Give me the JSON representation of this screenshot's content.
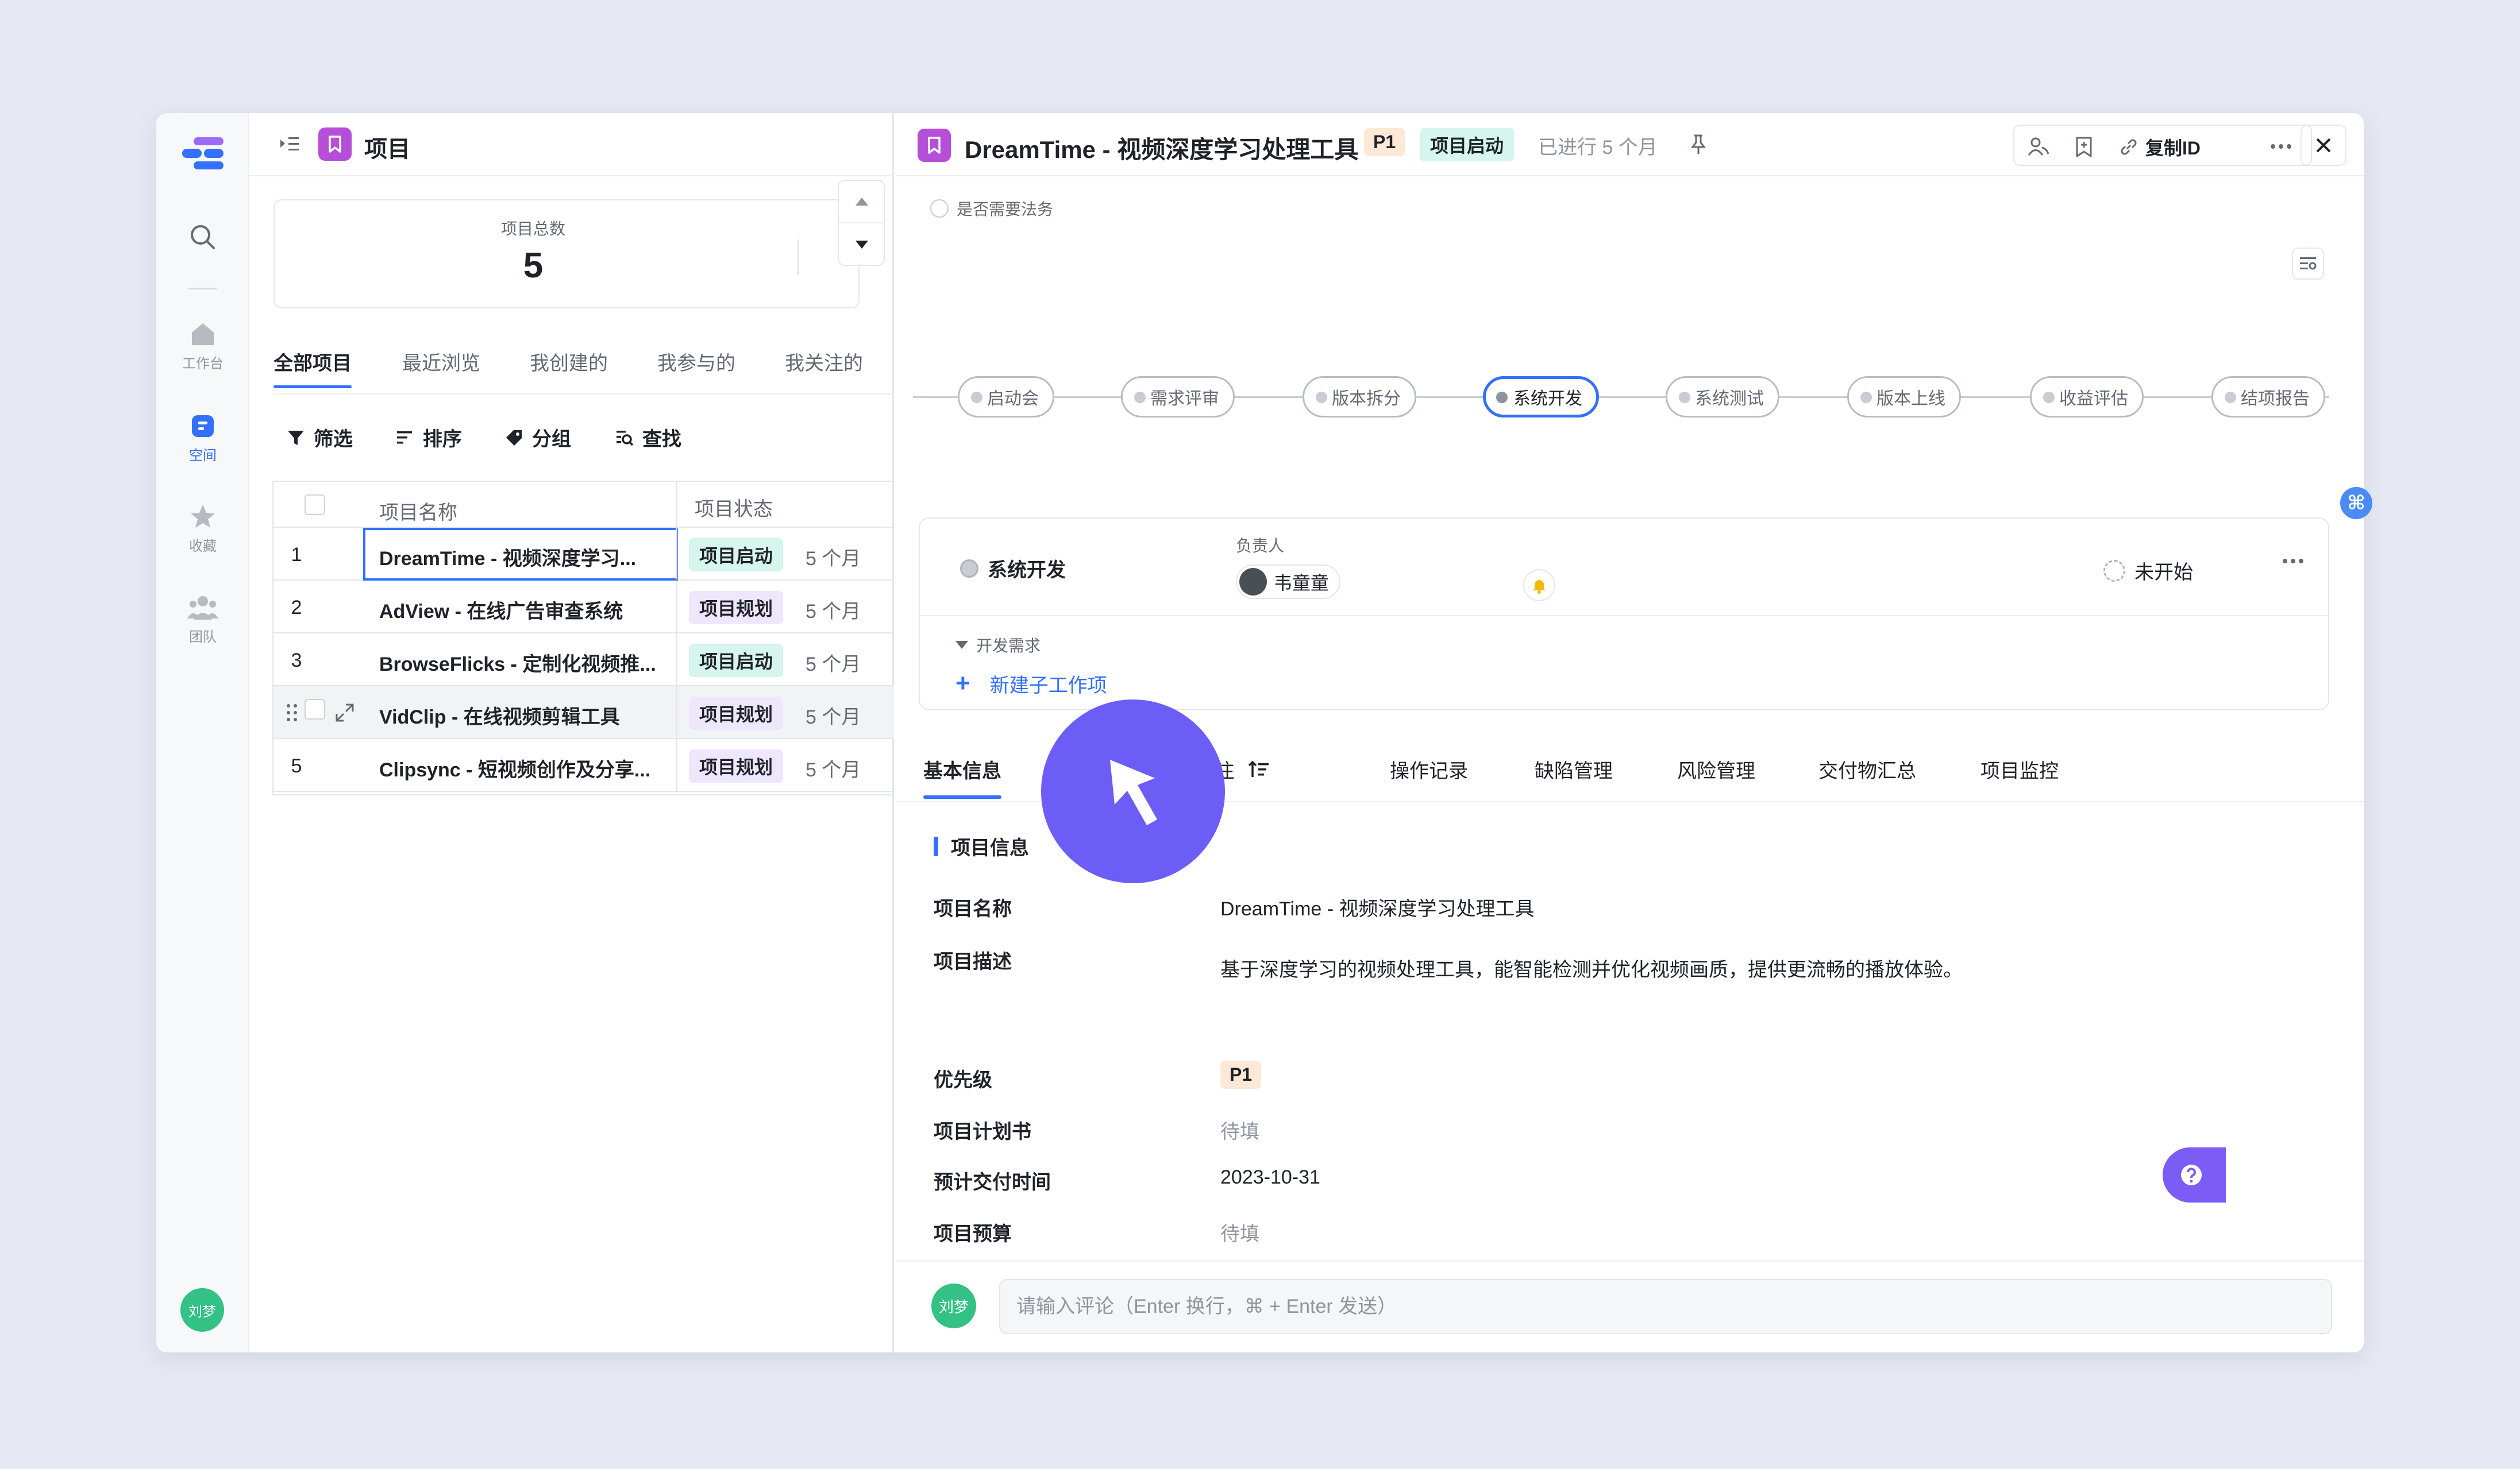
{
  "rail": {
    "items": [
      {
        "key": "workbench",
        "label": "工作台"
      },
      {
        "key": "space",
        "label": "空间"
      },
      {
        "key": "favorites",
        "label": "收藏"
      },
      {
        "key": "team",
        "label": "团队"
      }
    ],
    "user_avatar": "刘梦",
    "accent": "#3370ff"
  },
  "list": {
    "title": "项目",
    "stat_label": "项目总数",
    "stat_value": "5",
    "tabs": [
      "全部项目",
      "最近浏览",
      "我创建的",
      "我参与的",
      "我关注的"
    ],
    "toolbar": {
      "filter": "筛选",
      "sort": "排序",
      "group": "分组",
      "find": "查找"
    },
    "columns": {
      "name": "项目名称",
      "status": "项目状态"
    },
    "rows": [
      {
        "num": "1",
        "name": "DreamTime - 视频深度学习...",
        "status": "项目启动",
        "duration": "5 个月"
      },
      {
        "num": "2",
        "name": "AdView - 在线广告审查系统",
        "status": "项目规划",
        "duration": "5 个月"
      },
      {
        "num": "3",
        "name": "BrowseFlicks - 定制化视频推...",
        "status": "项目启动",
        "duration": "5 个月"
      },
      {
        "num": "",
        "name": "VidClip - 在线视频剪辑工具",
        "status": "项目规划",
        "duration": "5 个月"
      },
      {
        "num": "5",
        "name": "Clipsync - 短视频创作及分享...",
        "status": "项目规划",
        "duration": "5 个月"
      }
    ]
  },
  "detail": {
    "title": "DreamTime - 视频深度学习处理工具",
    "priority": "P1",
    "status": "项目启动",
    "elapsed": "已进行 5 个月",
    "copy_id": "复制ID",
    "legal_check": "是否需要法务",
    "stages": [
      "启动会",
      "需求评审",
      "版本拆分",
      "系统开发",
      "系统测试",
      "版本上线",
      "收益评估",
      "结项报告"
    ],
    "stage_card": {
      "name": "系统开发",
      "owner_label": "负责人",
      "owner": "韦童童",
      "state": "未开始",
      "sub_group": "开发需求",
      "new_sub": "新建子工作项"
    },
    "tabs": [
      "基本信息",
      "评论/备注",
      "操作记录",
      "缺陷管理",
      "风险管理",
      "交付物汇总",
      "项目监控"
    ],
    "section_title": "项目信息",
    "fields": {
      "name_label": "项目名称",
      "name_value": "DreamTime - 视频深度学习处理工具",
      "desc_label": "项目描述",
      "desc_value": "基于深度学习的视频处理工具，能智能检测并优化视频画质，提供更流畅的播放体验。",
      "priority_label": "优先级",
      "priority_value": "P1",
      "plan_label": "项目计划书",
      "plan_value": "待填",
      "delivery_label": "预计交付时间",
      "delivery_value": "2023-10-31",
      "budget_label": "项目预算",
      "budget_value": "待填"
    },
    "comment": {
      "avatar": "刘梦",
      "placeholder": "请输入评论（Enter 换行，⌘ + Enter 发送）"
    }
  }
}
